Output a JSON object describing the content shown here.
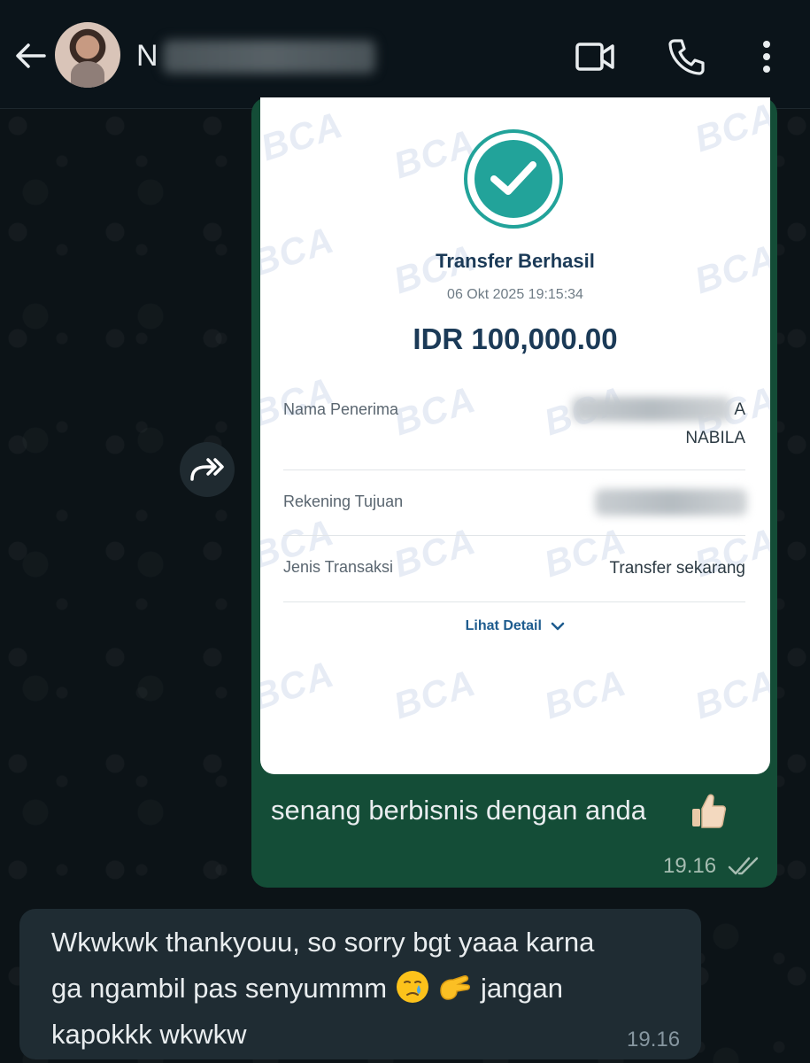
{
  "header": {
    "contact_name_visible": "N",
    "contact_name_redacted": true
  },
  "receipt": {
    "watermark": "BCA",
    "status_title": "Transfer Berhasil",
    "datetime": "06 Okt 2025 19:15:34",
    "amount": "IDR 100,000.00",
    "rows": [
      {
        "label": "Nama Penerima",
        "value_visible_end": "A",
        "value_line2": "NABILA"
      },
      {
        "label": "Rekening Tujuan",
        "value": "redacted"
      },
      {
        "label": "Jenis Transaksi",
        "value": "Transfer sekarang"
      }
    ],
    "detail_link": "Lihat Detail"
  },
  "outgoing": {
    "caption": "senang berbisnis dengan anda",
    "time": "19.16",
    "read_status": "read"
  },
  "incoming": {
    "line1": "Wkwkwk thankyouu, so sorry bgt yaaa karna",
    "line2_a": "ga ngambil pas senyummm",
    "line2_b": "jangan",
    "line3": "kapokkk wkwkw",
    "time": "19.16"
  },
  "colors": {
    "outgoing_bubble": "#144d37",
    "incoming_bubble": "#1f2c33",
    "accent_teal": "#22a39a",
    "receipt_navy": "#1b3a57"
  },
  "icons": [
    "back-arrow-icon",
    "video-call-icon",
    "phone-icon",
    "more-vert-icon",
    "forward-icon",
    "check-icon",
    "chevron-down-icon",
    "double-check-icon",
    "thumbs-up-emoji",
    "tear-emoji",
    "pinch-emoji"
  ]
}
